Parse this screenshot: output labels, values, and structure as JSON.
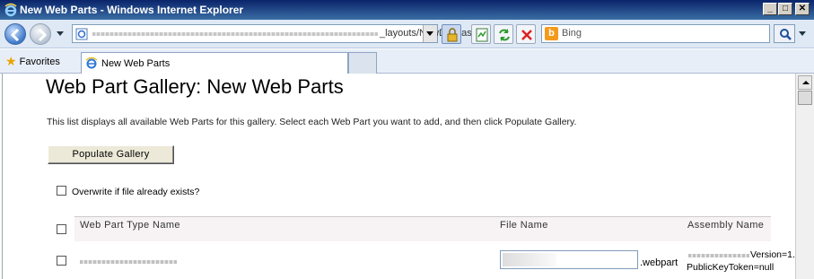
{
  "window": {
    "title": "New Web Parts - Windows Internet Explorer",
    "minimize": "_",
    "maximize": "□",
    "close": "✕"
  },
  "address_bar": {
    "url_visible": "_layouts/NewDwp.aspx"
  },
  "search": {
    "placeholder": "Bing"
  },
  "favorites": {
    "label": "Favorites"
  },
  "tab": {
    "label": "New Web Parts"
  },
  "page": {
    "title": "Web Part Gallery: New Web Parts",
    "description": "This list displays all available Web Parts for this gallery. Select each Web Part you want to add, and then click Populate Gallery.",
    "populate_button": "Populate Gallery",
    "overwrite_label": "Overwrite if file already exists?",
    "table": {
      "headers": [
        "Web Part Type Name",
        "File Name",
        "Assembly Name"
      ],
      "rows": [
        {
          "file_extension": ".webpart",
          "assembly_version": "Version=1.",
          "assembly_token": "PublicKeyToken=null"
        }
      ]
    }
  },
  "colors": {
    "titlebar": "#0a246a",
    "toolbar": "#dfe9f5",
    "header_row": "#f7f2f4"
  }
}
